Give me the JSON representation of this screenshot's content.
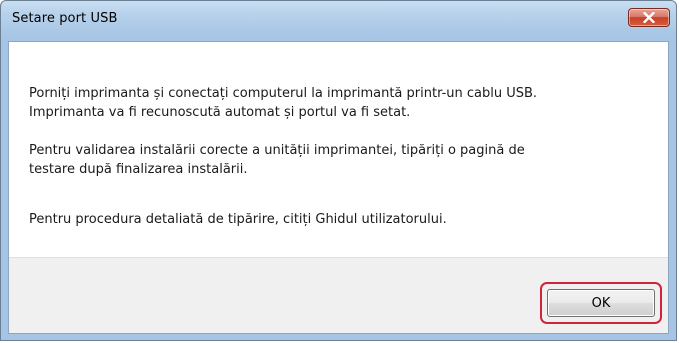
{
  "window": {
    "title": "Setare port USB"
  },
  "titlebar": {
    "close_icon": "close-x-icon",
    "close_color": "#c6402a"
  },
  "message": {
    "p1_line1": "Porniți imprimanta și conectați computerul la imprimantă printr-un cablu USB.",
    "p1_line2": "Imprimanta va fi recunoscută automat și portul va fi setat.",
    "p2_line1": "Pentru validarea instalării corecte a unității imprimantei, tipăriți o pagină de",
    "p2_line2": "testare după finalizarea instalării.",
    "p3_line1": "Pentru procedura detaliată de tipărire, citiți Ghidul utilizatorului."
  },
  "footer": {
    "ok_label": "OK",
    "highlight_color": "#d0243a"
  }
}
